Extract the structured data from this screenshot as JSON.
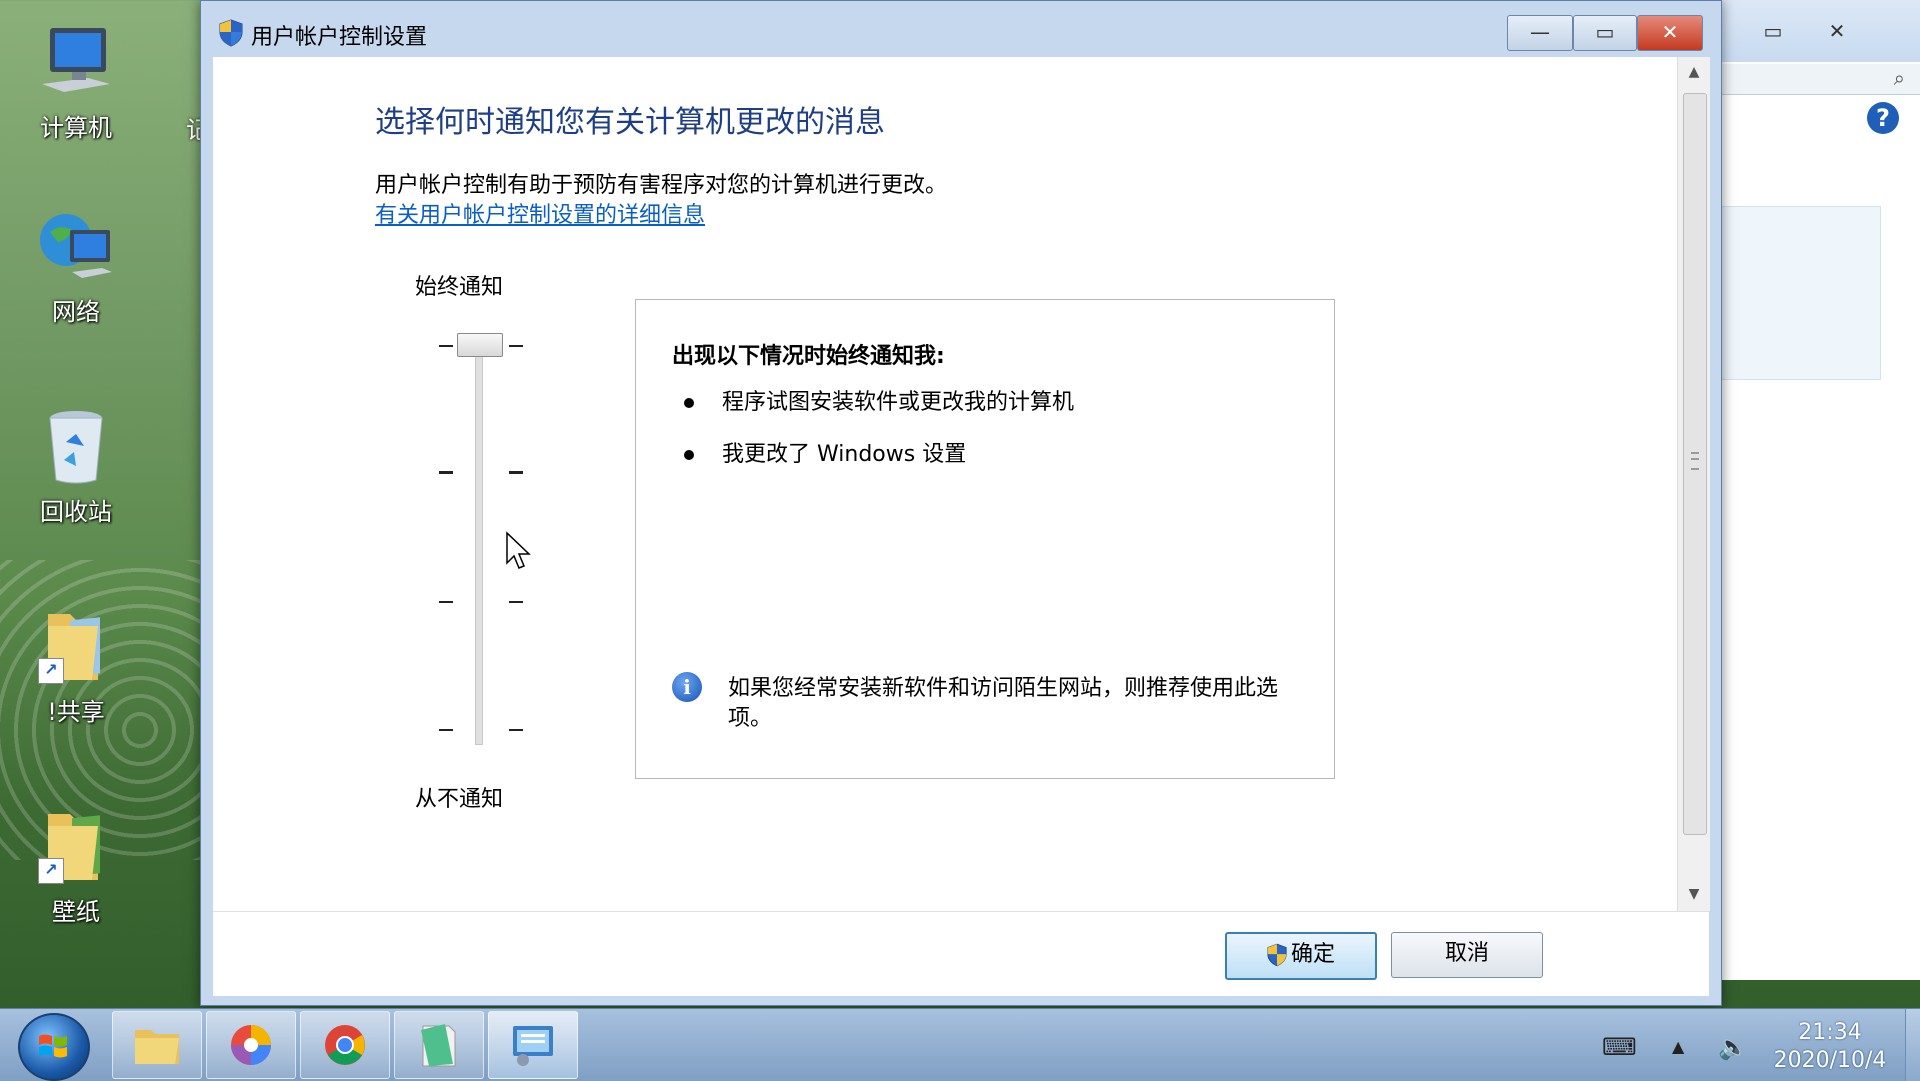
{
  "desktop": {
    "icons": [
      {
        "label": "计算机"
      },
      {
        "label": "网络"
      },
      {
        "label": "回收站"
      },
      {
        "label": "!共享"
      },
      {
        "label": "壁纸"
      }
    ],
    "partial_label": "记"
  },
  "dialog": {
    "title": "用户帐户控制设置",
    "heading": "选择何时通知您有关计算机更改的消息",
    "description": "用户帐户控制有助于预防有害程序对您的计算机进行更改。",
    "link": "有关用户帐户控制设置的详细信息",
    "slider": {
      "top_label": "始终通知",
      "bottom_label": "从不通知",
      "level": 4,
      "levels": 4
    },
    "info": {
      "title": "出现以下情况时始终通知我:",
      "items": [
        "程序试图安装软件或更改我的计算机",
        "我更改了 Windows 设置"
      ],
      "note": "如果您经常安装新软件和访问陌生网站，则推荐使用此选项。"
    },
    "buttons": {
      "ok": "确定",
      "cancel": "取消"
    }
  },
  "taskbar": {
    "clock_time": "21:34",
    "clock_date": "2020/10/4"
  },
  "colors": {
    "heading": "#1e3f86",
    "link": "#0b5fc4",
    "close_button": "#c43a20",
    "taskbar": "#8fadd0"
  }
}
